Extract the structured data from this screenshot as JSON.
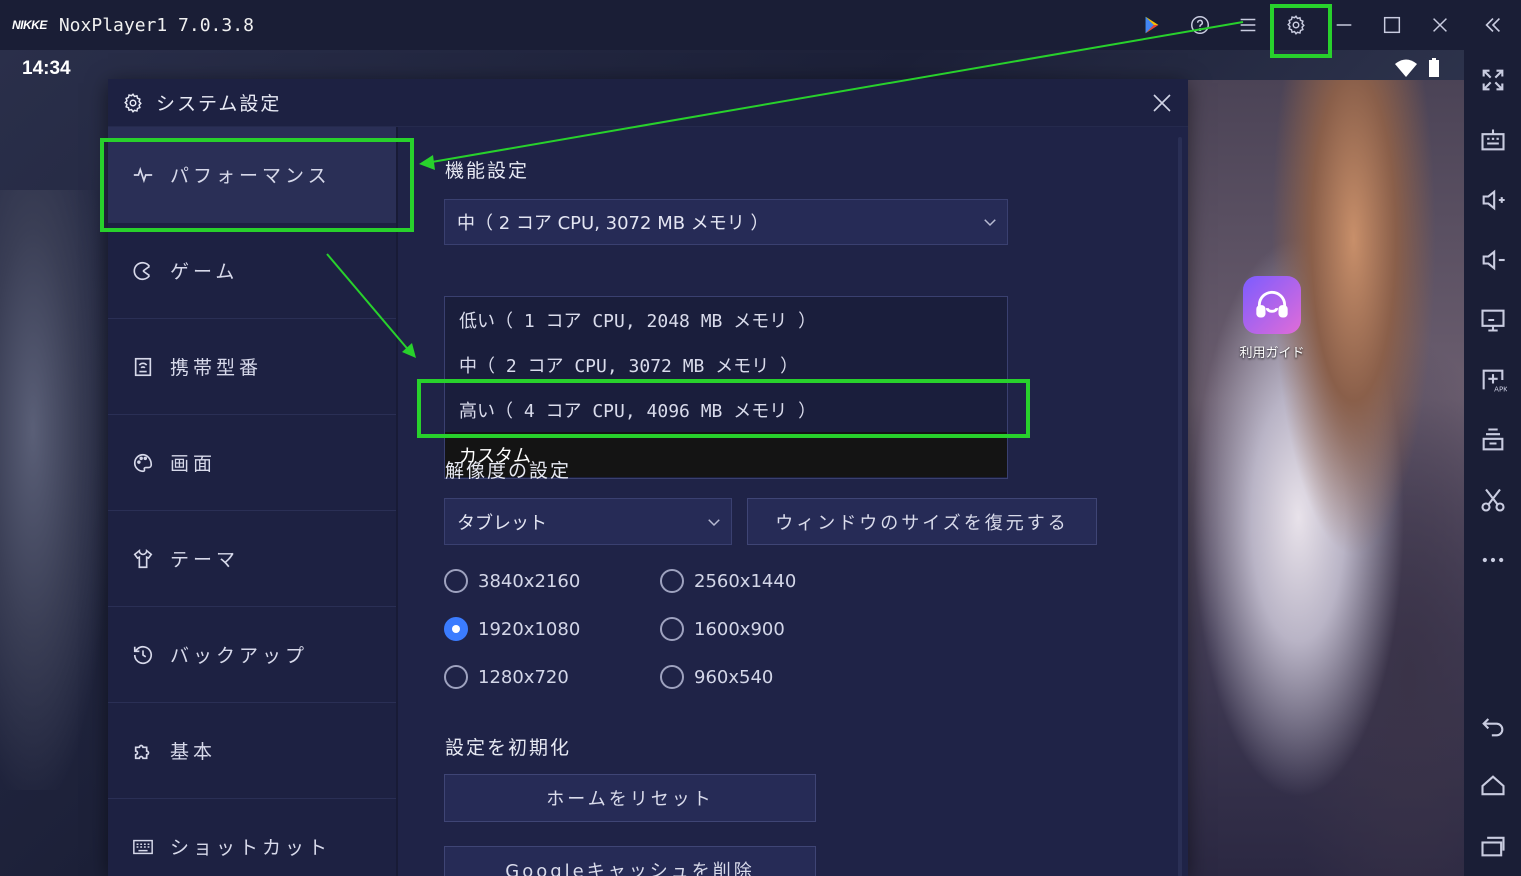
{
  "window": {
    "logo_text": "NIKKE",
    "title": "NoxPlayer1 7.0.3.8"
  },
  "status_bar": {
    "time": "14:34"
  },
  "home_app": {
    "label": "利用ガイド"
  },
  "dialog": {
    "title": "システム設定",
    "sidebar": [
      {
        "label": "パフォーマンス",
        "icon": "pulse-icon",
        "active": true
      },
      {
        "label": "ゲーム",
        "icon": "gamepad-icon"
      },
      {
        "label": "携帯型番",
        "icon": "phone-icon"
      },
      {
        "label": "画面",
        "icon": "palette-icon"
      },
      {
        "label": "テーマ",
        "icon": "shirt-icon"
      },
      {
        "label": "バックアップ",
        "icon": "history-icon"
      },
      {
        "label": "基本",
        "icon": "puzzle-icon"
      },
      {
        "label": "ショットカット",
        "icon": "keyboard-icon"
      }
    ],
    "performance": {
      "section_title": "機能設定",
      "selected": "中（ 2 コア CPU, 3072 MB メモリ ）",
      "options": [
        "低い（ 1 コア CPU, 2048 MB メモリ ）",
        "中（ 2 コア CPU, 3072 MB メモリ ）",
        "高い（ 4 コア CPU, 4096 MB メモリ ）",
        "カスタム"
      ]
    },
    "resolution": {
      "section_title": "解像度の設定",
      "mode": "タブレット",
      "restore_button": "ウィンドウのサイズを復元する",
      "options": [
        {
          "label": "3840x2160"
        },
        {
          "label": "2560x1440"
        },
        {
          "label": "1920x1080",
          "checked": true
        },
        {
          "label": "1600x900"
        },
        {
          "label": "1280x720"
        },
        {
          "label": "960x540"
        }
      ]
    },
    "reset": {
      "section_title": "設定を初期化",
      "home_reset_button": "ホームをリセット",
      "google_cache_button": "Googleキャッシュを削除"
    }
  },
  "colors": {
    "highlight": "#28d12c",
    "accent": "#3b7cff"
  }
}
